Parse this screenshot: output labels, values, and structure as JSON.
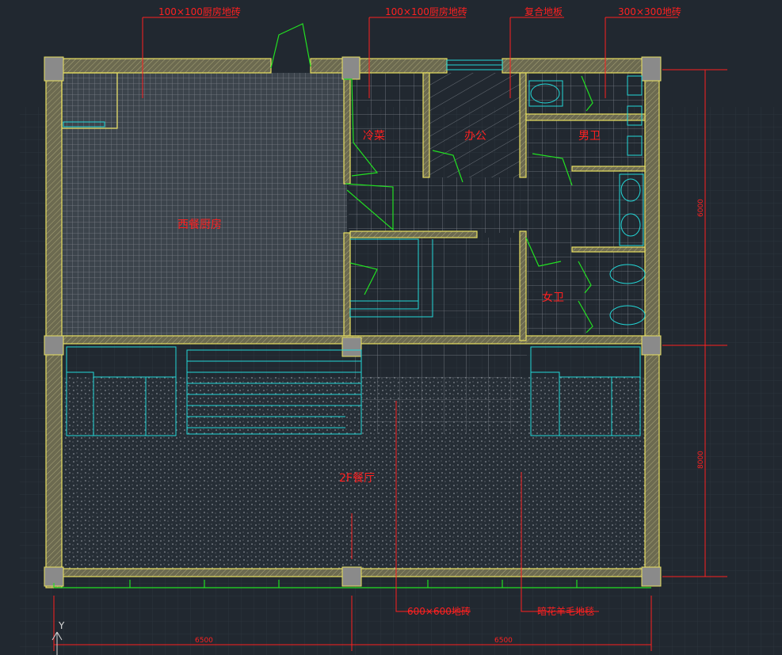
{
  "drawing": {
    "callouts": {
      "kitchen_tile_1": "100×100厨房地砖",
      "kitchen_tile_2": "100×100厨房地砖",
      "composite_floor": "复合地板",
      "tile_300": "300×300地砖",
      "tile_600": "600×600地砖",
      "carpet": "暗花羊毛地毯"
    },
    "rooms": {
      "western_kitchen": "西餐厨房",
      "cold_dish": "冷菜",
      "office": "办公",
      "mens_toilet": "男卫",
      "womens_toilet": "女卫",
      "dining_hall": "2F餐厅"
    },
    "dimensions": {
      "bottom_left": "6500",
      "bottom_right": "6500",
      "right_top": "6000",
      "right_bottom": "8000"
    },
    "ucs_label": "Y"
  },
  "colors": {
    "background": "#212830",
    "wall_outline": "#e8e060",
    "column_fill": "#8a8a8a",
    "grid_lines": "#6a7078",
    "furniture_cyan": "#22d8d8",
    "doors_green": "#22e022",
    "text_red": "#ff2020"
  }
}
